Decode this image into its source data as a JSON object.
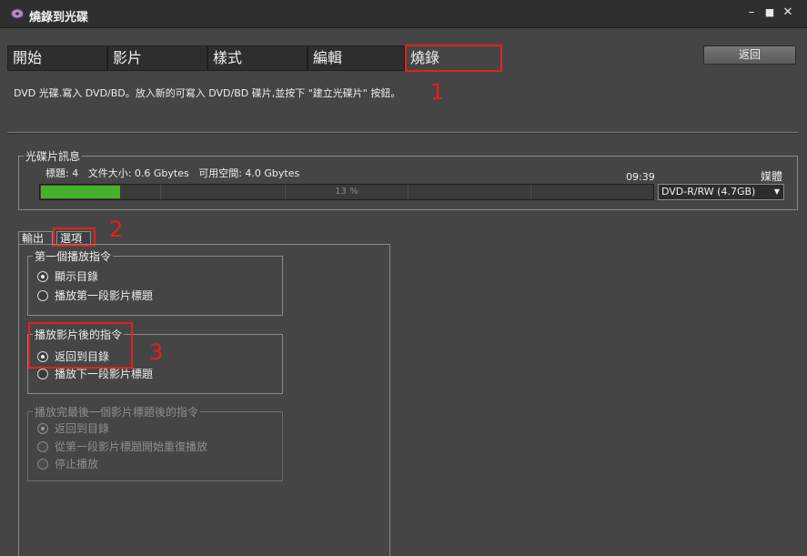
{
  "window": {
    "title": "燒錄到光碟",
    "controls": [
      "–",
      "■",
      "✕"
    ]
  },
  "tabs": [
    "開始",
    "影片",
    "樣式",
    "編輯",
    "燒錄"
  ],
  "back_button": "返回",
  "status_message": "DVD 光碟.寫入 DVD/BD。放入新的可寫入 DVD/BD 碟片,並按下 \"建立光碟片\" 按鈕。",
  "disc_info": {
    "legend": "光碟片訊息",
    "stats": "標題: 4   文件大小: 0.6 Gbytes   可用空間: 4.0 Gbytes",
    "time": "09:39",
    "progress_label": "13 %",
    "progress_fraction": 0.13,
    "media_label": "媒體",
    "media_selected": "DVD-R/RW (4.7GB)"
  },
  "subtabs": [
    "輸出",
    "選項"
  ],
  "first_play": {
    "legend": "第一個播放指令",
    "options": [
      "顯示目錄",
      "播放第一段影片標題"
    ],
    "selected": 0
  },
  "after_title": {
    "legend": "播放影片後的指令",
    "options": [
      "返回到目錄",
      "播放下一段影片標題"
    ],
    "selected": 0
  },
  "after_last": {
    "legend": "播放完最後一個影片標題後的指令",
    "options": [
      "返回到目錄",
      "從第一段影片標題開始重復播放",
      "停止播放"
    ],
    "selected": 0,
    "disabled": true
  },
  "annotations": [
    "1",
    "2",
    "3"
  ],
  "colors": {
    "accent_red": "#e2211f",
    "progress_green": "#48b02b"
  }
}
